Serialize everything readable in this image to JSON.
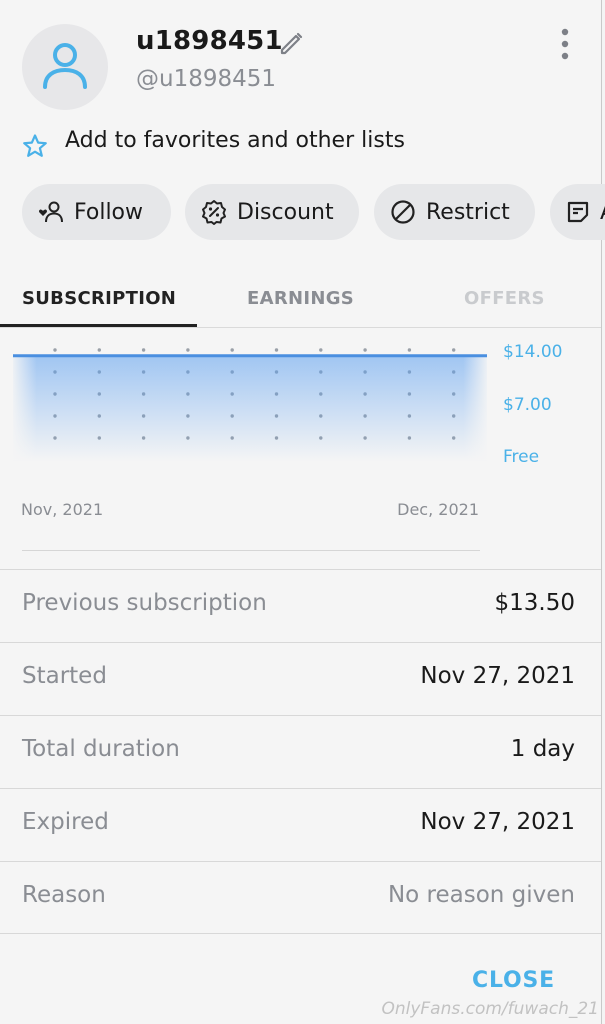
{
  "profile": {
    "name": "u1898451",
    "handle": "@u1898451",
    "favorites_label": "Add to favorites and other lists"
  },
  "actions": [
    {
      "label": "Follow",
      "icon": "person-heart-icon"
    },
    {
      "label": "Discount",
      "icon": "discount-badge-icon"
    },
    {
      "label": "Restrict",
      "icon": "block-icon"
    },
    {
      "label": "A",
      "icon": "note-icon"
    }
  ],
  "tabs": [
    {
      "label": "SUBSCRIPTION",
      "state": "active"
    },
    {
      "label": "EARNINGS",
      "state": "normal"
    },
    {
      "label": "OFFERS",
      "state": "disabled"
    }
  ],
  "chart_data": {
    "type": "area",
    "x_labels": [
      "Nov, 2021",
      "Dec, 2021"
    ],
    "y_tick_labels": [
      "$14.00",
      "$7.00",
      "Free"
    ],
    "ylim": [
      0,
      14
    ],
    "series": [
      {
        "values": [
          13.5,
          13.5,
          13.5,
          13.5,
          13.5,
          13.5,
          13.5,
          13.5,
          13.5,
          13.5,
          13.5,
          13.5
        ]
      }
    ],
    "colors": {
      "line": "#4a8fe0",
      "tick": "#4ab1e8"
    }
  },
  "details": [
    {
      "label": "Previous subscription",
      "value": "$13.50",
      "muted": false
    },
    {
      "label": "Started",
      "value": "Nov 27, 2021",
      "muted": false
    },
    {
      "label": "Total duration",
      "value": "1 day",
      "muted": false
    },
    {
      "label": "Expired",
      "value": "Nov 27, 2021",
      "muted": false
    },
    {
      "label": "Reason",
      "value": "No reason given",
      "muted": true
    }
  ],
  "footer": {
    "close_label": "CLOSE",
    "watermark": "OnlyFans.com/fuwach_21"
  },
  "colors": {
    "accent": "#4ab1e8",
    "text": "#1a1a1a",
    "muted": "#8a8d93"
  }
}
